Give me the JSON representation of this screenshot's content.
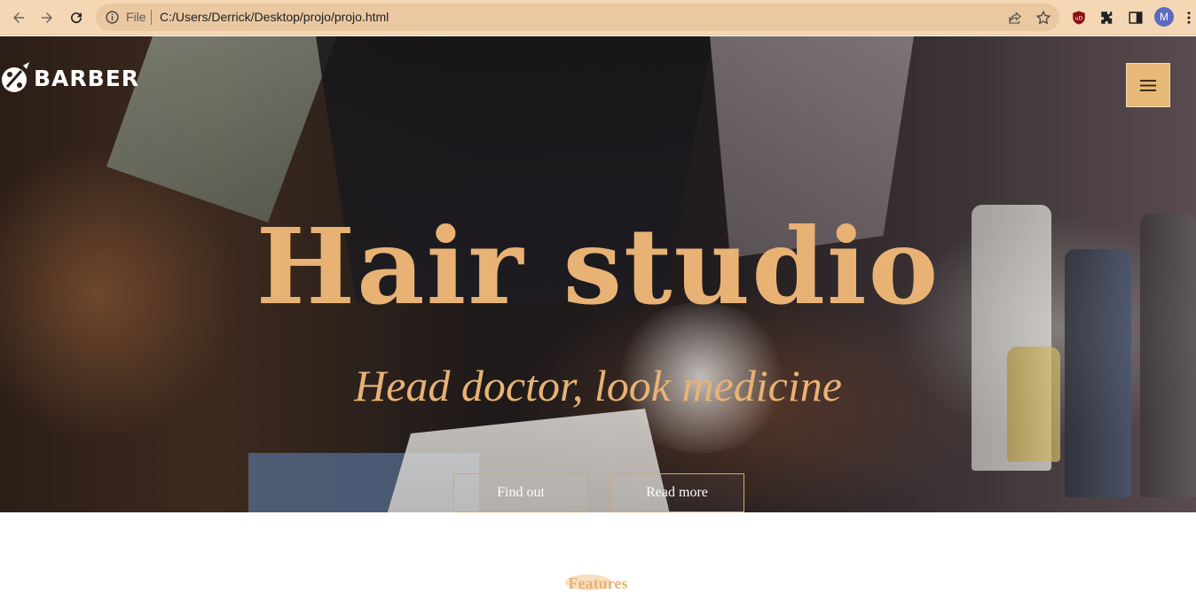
{
  "browser": {
    "address_scheme": "File",
    "address_url": "C:/Users/Derrick/Desktop/projo/projo.html",
    "profile_initial": "M",
    "icons": [
      "back-arrow-icon",
      "forward-arrow-icon",
      "reload-icon",
      "info-icon",
      "share-icon",
      "star-icon",
      "ublock-icon",
      "extensions-puzzle-icon",
      "side-panel-icon",
      "kebab-menu-icon"
    ],
    "colors": {
      "toolbar": "#f4d7b4",
      "omnibox": "#e9c8a2"
    }
  },
  "site": {
    "logo_text": "BARBER",
    "hero_title": "Hair studio",
    "hero_subtitle": "Head doctor, look medicine",
    "buttons": {
      "find_out": "Find out",
      "read_more": "Read more"
    },
    "features_heading": "Features",
    "colors": {
      "accent": "#e8b275",
      "menu_button": "#e8b878",
      "button_border": "#d7a768"
    }
  }
}
